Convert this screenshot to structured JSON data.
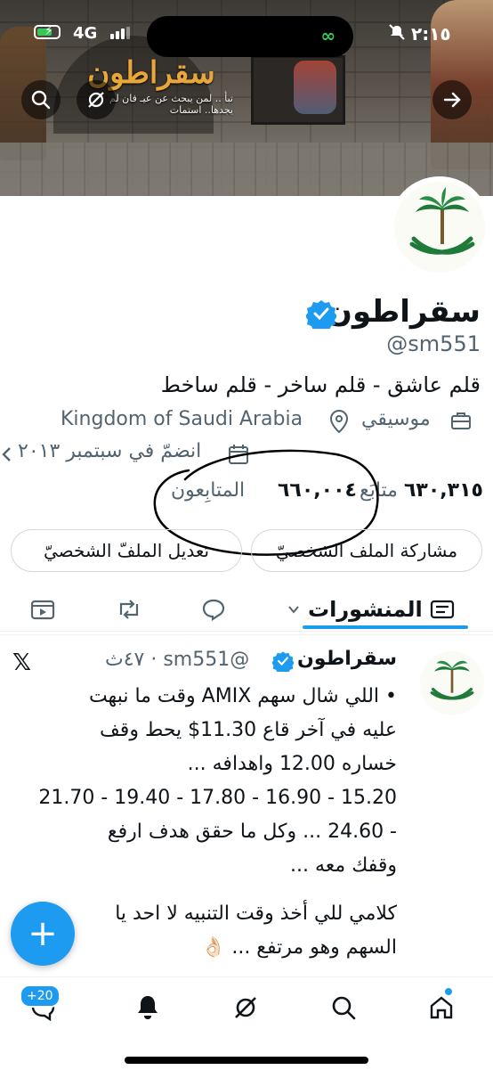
{
  "status_bar": {
    "network": "4G",
    "time": "٢:١٥"
  },
  "banner": {
    "brand_text": "سقراطون",
    "tagline": "تبأ .. لمن يبحث عن عيـ فان لم يجدها.. استمات"
  },
  "profile": {
    "name": "سقراطون",
    "handle": "@sm551",
    "bio": "قلم عاشق - قلم ساخر - قلم ساخط",
    "location": "Kingdom of Saudi Arabia",
    "category": "موسيقي",
    "joined": "انضمّ في سبتمبر ٢٠١٣",
    "following_count": "٦٣٠,٣١٥",
    "following_label": "متابَع",
    "followers_count": "٦٦٠,٠٠٤",
    "followers_label": "المتابِعون"
  },
  "actions": {
    "share": "مشاركة الملف الشخصيّ",
    "edit": "تعديل الملفّ الشخصيّ"
  },
  "tabs": {
    "posts": "المنشورات"
  },
  "post": {
    "name": "سقراطون",
    "handle_time": "@sm551 · ٤٧ث",
    "lines": [
      "• اللي شال سهم AMIX وقت ما نبهت",
      "عليه في آخر قاع 11.30$ يحط وقف",
      "خساره 12.00 واهدافه ...",
      "15.20 - 16.90 - 17.80 - 19.40 - 21.70",
      "- 24.60 ... وكل ما حقق هدف ارفع",
      "وقفك معه ..."
    ],
    "lines2": [
      "كلامي للي أخذ وقت التنبيه لا احد يا",
      "السهم وهو مرتفع ... 👌🏻"
    ]
  },
  "fab": {
    "label": "+"
  },
  "bottom_nav": {
    "messages_badge": "+20"
  }
}
